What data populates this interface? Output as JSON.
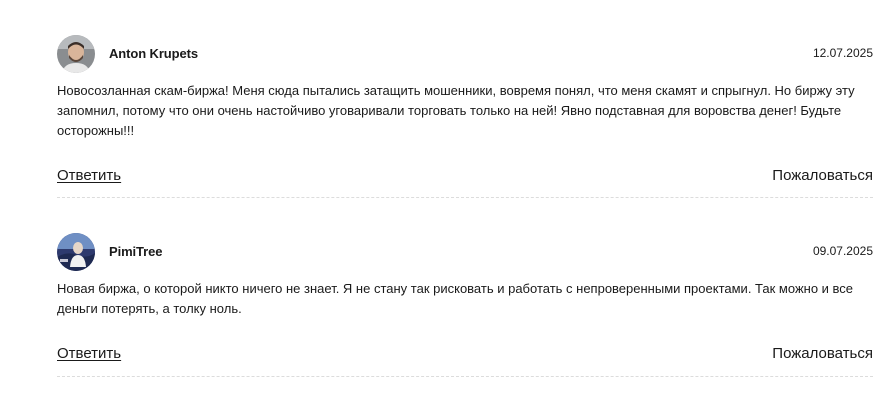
{
  "comments": [
    {
      "author": "Anton Krupets",
      "date": "12.07.2025",
      "text": "Новосозланная скам-биржа! Меня сюда пытались затащить мошенники, вовремя понял, что меня скамят и спрыгнул. Но биржу эту запомнил, потому что они очень настойчиво уговаривали торговать только на ней! Явно подставная для воровства денег! Будьте осторожны!!!",
      "reply_label": "Ответить",
      "report_label": "Пожаловаться",
      "avatar_icon": "user-photo-avatar"
    },
    {
      "author": "PimiTree",
      "date": "09.07.2025",
      "text": "Новая биржа, о которой никто ничего не знает. Я не стану так рисковать и работать с непроверенными проектами. Так можно и все деньги потерять, а толку ноль.",
      "reply_label": "Ответить",
      "report_label": "Пожаловаться",
      "avatar_icon": "user-photo-avatar"
    }
  ]
}
